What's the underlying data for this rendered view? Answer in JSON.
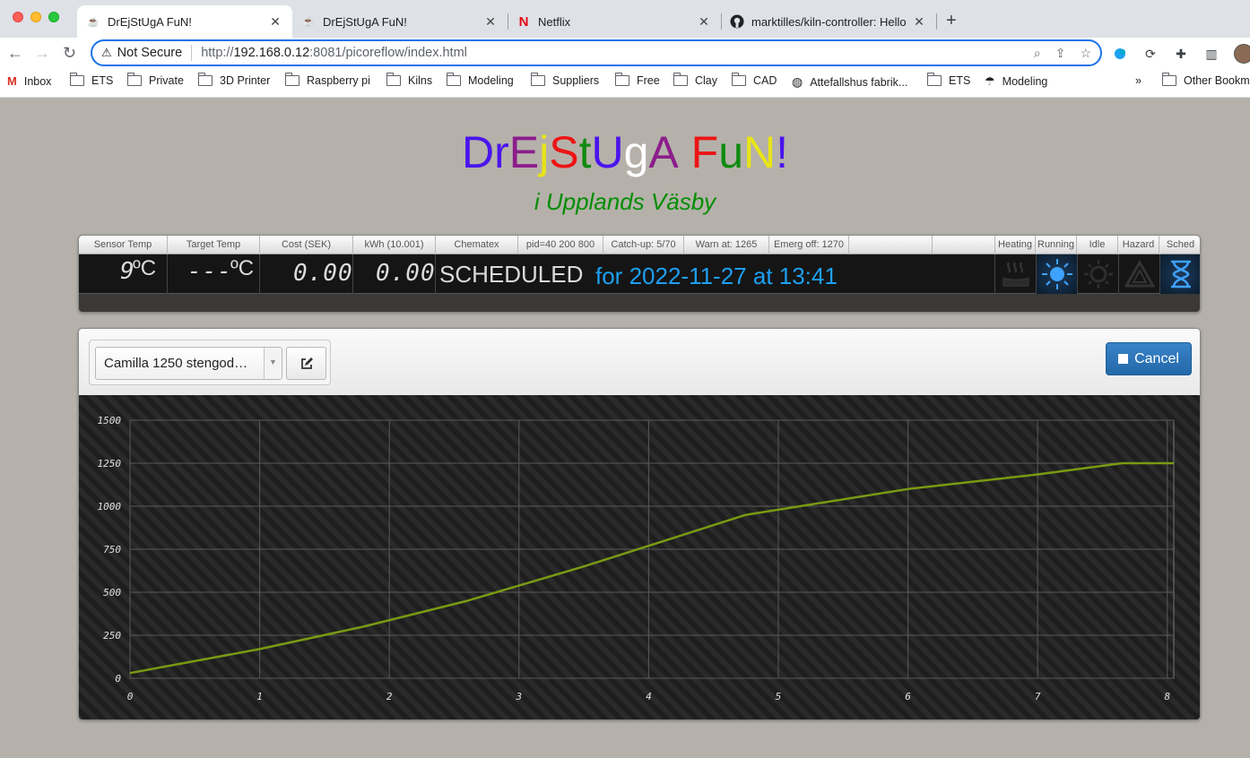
{
  "browser": {
    "tabs": [
      {
        "title": "DrEjStUgA FuN!",
        "favicon": "coffee-icon",
        "active": true
      },
      {
        "title": "DrEjStUgA FuN!",
        "favicon": "coffee-icon",
        "active": false
      },
      {
        "title": "Netflix",
        "favicon": "netflix-icon",
        "active": false
      },
      {
        "title": "marktilles/kiln-controller: Hello",
        "favicon": "github-icon",
        "active": false
      }
    ],
    "not_secure": "Not Secure",
    "url_prefix": "http://",
    "url_host": "192.168.0.12",
    "url_rest": ":8081/picoreflow/index.html",
    "bookmarks": [
      "Inbox",
      "ETS",
      "Private",
      "3D Printer",
      "Raspberry pi",
      "Kilns",
      "Modeling",
      "Suppliers",
      "Free",
      "Clay",
      "CAD",
      "Attefallshus fabrik...",
      "ETS",
      "Modeling"
    ],
    "overflow": "»",
    "other_bookmarks": "Other Bookm"
  },
  "page": {
    "title_letters": [
      {
        "ch": "D",
        "color": "#4a14ee"
      },
      {
        "ch": "r",
        "color": "#4a14ee"
      },
      {
        "ch": "E",
        "color": "#8c1d8c"
      },
      {
        "ch": "j",
        "color": "#e8e418"
      },
      {
        "ch": "S",
        "color": "#ec1414"
      },
      {
        "ch": "t",
        "color": "#108a10"
      },
      {
        "ch": "U",
        "color": "#4a14ee"
      },
      {
        "ch": "g",
        "color": "#ffffff"
      },
      {
        "ch": "A",
        "color": "#8c1d8c"
      },
      {
        "ch": " ",
        "color": "#000000"
      },
      {
        "ch": "F",
        "color": "#ec1414"
      },
      {
        "ch": "u",
        "color": "#108a10"
      },
      {
        "ch": "N",
        "color": "#e8e418"
      },
      {
        "ch": "!",
        "color": "#4a14ee"
      }
    ],
    "subtitle": "i Upplands Väsby"
  },
  "status": {
    "headers": [
      "Sensor Temp",
      "Target Temp",
      "Cost (SEK)",
      "kWh (10.001)",
      "Chematex",
      "pid=40 200 800",
      "Catch-up: 5/70",
      "Warn at: 1265",
      "Emerg off: 1270",
      ""
    ],
    "indicator_labels": [
      "Heating",
      "Running",
      "Idle",
      "Hazard",
      "Sched"
    ],
    "sensor_temp": "9",
    "sensor_unit": "ºC",
    "target_temp": "---",
    "target_unit": "ºC",
    "cost": "0.00",
    "kwh": "0.00",
    "state": "SCHEDULED",
    "schedule": "for 2022-11-27 at 13:41",
    "indicators": {
      "heating": false,
      "running": true,
      "idle": false,
      "hazard": false,
      "sched": true
    },
    "colors": {
      "active": "#3fa2ff",
      "inactive": "#2a2a2a"
    }
  },
  "profile": {
    "selected": "Camilla 1250 stengod…",
    "cancel_label": "Cancel"
  },
  "chart_data": {
    "type": "line",
    "x": [
      0,
      1,
      1.8,
      2.6,
      3.5,
      4.75,
      6,
      7,
      7.65,
      8.05
    ],
    "series": [
      {
        "values": [
          30,
          170,
          300,
          450,
          650,
          950,
          1100,
          1185,
          1250,
          1250
        ],
        "color": "#7a9a12"
      }
    ],
    "xticks": [
      0,
      1,
      2,
      3,
      4,
      5,
      6,
      7,
      8
    ],
    "yticks": [
      0,
      250,
      500,
      750,
      1000,
      1250,
      1500
    ],
    "xlim": [
      0,
      8.05
    ],
    "ylim": [
      0,
      1500
    ],
    "grid": true
  }
}
